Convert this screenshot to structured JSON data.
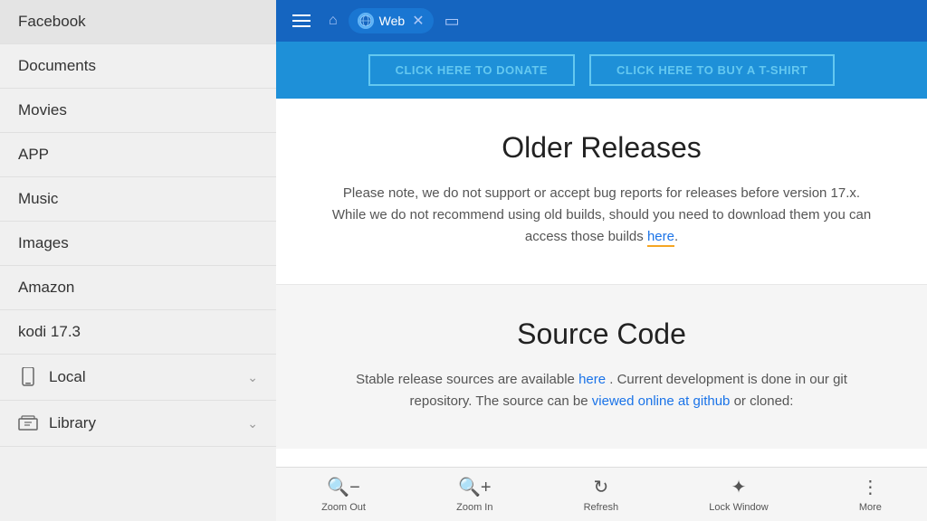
{
  "sidebar": {
    "items": [
      {
        "label": "Facebook",
        "hasIcon": false
      },
      {
        "label": "Documents",
        "hasIcon": false
      },
      {
        "label": "Movies",
        "hasIcon": false
      },
      {
        "label": "APP",
        "hasIcon": false
      },
      {
        "label": "Music",
        "hasIcon": false
      },
      {
        "label": "Images",
        "hasIcon": false
      },
      {
        "label": "Amazon",
        "hasIcon": false
      },
      {
        "label": "kodi 17.3",
        "hasIcon": false
      }
    ],
    "local_label": "Local",
    "library_label": "Library"
  },
  "toolbar": {
    "tab_label": "Web"
  },
  "web": {
    "donate_btn1": "CLICK HERE TO DONATE",
    "donate_btn2": "CLICK HERE TO BUY A T-SHIRT",
    "older_releases_title": "Older Releases",
    "older_releases_text": "Please note, we do not support or accept bug reports for releases before version 17.x. While we do not recommend using old builds, should you need to download them you can access those builds",
    "older_releases_link": "here",
    "source_code_title": "Source Code",
    "source_code_text1": "Stable release sources are available",
    "source_code_link1": "here",
    "source_code_text2": ". Current development is done in our git repository. The source can be",
    "source_code_link2": "viewed online at github",
    "source_code_text3": "or cloned:"
  },
  "bottom_bar": {
    "zoom_out_label": "Zoom Out",
    "zoom_in_label": "Zoom In",
    "refresh_label": "Refresh",
    "lock_window_label": "Lock Window",
    "more_label": "More"
  }
}
